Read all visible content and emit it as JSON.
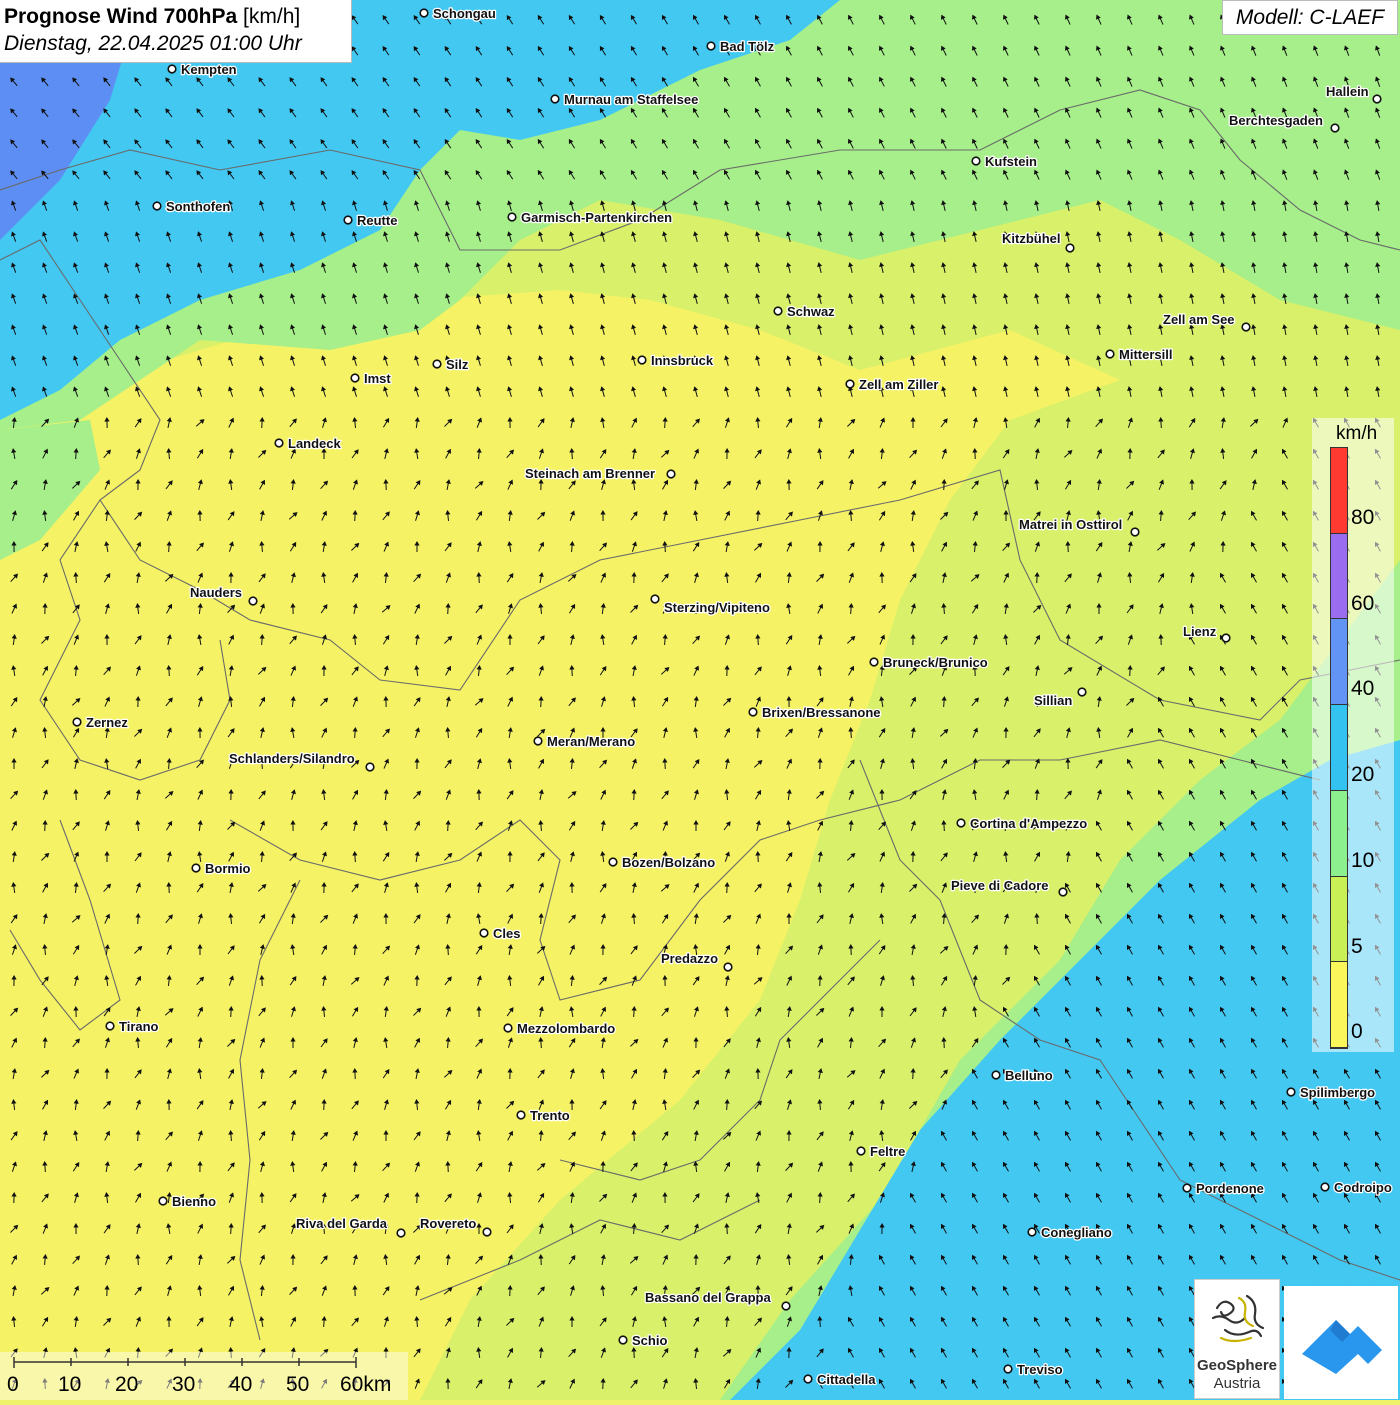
{
  "header": {
    "title_main": "Prognose Wind 700hPa",
    "title_unit": " [km/h]",
    "datetime": "Dienstag, 22.04.2025 01:00 Uhr",
    "model": "Modell: C-LAEF"
  },
  "legend": {
    "unit": "km/h",
    "ticks": [
      "80",
      "60",
      "40",
      "20",
      "10",
      "5",
      "0"
    ],
    "colors": [
      "#ff3a30",
      "#9a6cf0",
      "#6294f5",
      "#34c2f0",
      "#8cf08e",
      "#c9f055",
      "#fbf65a"
    ]
  },
  "scale_bar": {
    "labels": [
      "0",
      "10",
      "20",
      "30",
      "40",
      "50",
      "60km"
    ]
  },
  "logos": {
    "geosphere_line1": "GeoSphere",
    "geosphere_line2": "Austria"
  },
  "map": {
    "colors": {
      "calm": "#f5f265",
      "light": "#d8f06a",
      "moderate": "#a6ef8a",
      "fresh": "#43c8f2",
      "strong": "#5d8ef3",
      "border": "#6a6a6a",
      "arrow": "#111111"
    },
    "cities": [
      {
        "name": "Schongau"
      },
      {
        "name": "Bad Tölz"
      },
      {
        "name": "Kempten"
      },
      {
        "name": "Murnau am Staffelsee"
      },
      {
        "name": "Hallein"
      },
      {
        "name": "Berchtesgaden"
      },
      {
        "name": "Kufstein"
      },
      {
        "name": "Sonthofen"
      },
      {
        "name": "Reutte"
      },
      {
        "name": "Garmisch-Partenkirchen"
      },
      {
        "name": "Kitzbühel"
      },
      {
        "name": "Schwaz"
      },
      {
        "name": "Zell am See"
      },
      {
        "name": "Mittersill"
      },
      {
        "name": "Innsbruck"
      },
      {
        "name": "Silz"
      },
      {
        "name": "Imst"
      },
      {
        "name": "Zell am Ziller"
      },
      {
        "name": "Landeck"
      },
      {
        "name": "Steinach am Brenner"
      },
      {
        "name": "Matrei in Osttirol"
      },
      {
        "name": "Nauders"
      },
      {
        "name": "Sterzing/Vipiteno"
      },
      {
        "name": "Lienz"
      },
      {
        "name": "Bruneck/Brunico"
      },
      {
        "name": "Sillian"
      },
      {
        "name": "Zernez"
      },
      {
        "name": "Brixen/Bressanone"
      },
      {
        "name": "Meran/Merano"
      },
      {
        "name": "Schlanders/Silandro"
      },
      {
        "name": "Cortina d'Ampezzo"
      },
      {
        "name": "Bozen/Bolzano"
      },
      {
        "name": "Bormio"
      },
      {
        "name": "Pieve di Cadore"
      },
      {
        "name": "Cles"
      },
      {
        "name": "Predazzo"
      },
      {
        "name": "Tirano"
      },
      {
        "name": "Mezzolombardo"
      },
      {
        "name": "Belluno"
      },
      {
        "name": "Spilimbergo"
      },
      {
        "name": "Trento"
      },
      {
        "name": "Feltre"
      },
      {
        "name": "Bienno"
      },
      {
        "name": "Pordenone"
      },
      {
        "name": "Codroipo"
      },
      {
        "name": "Riva del Garda"
      },
      {
        "name": "Rovereto"
      },
      {
        "name": "Conegliano"
      },
      {
        "name": "Bassano del Grappa"
      },
      {
        "name": "Schio"
      },
      {
        "name": "Treviso"
      },
      {
        "name": "Cittadella"
      }
    ]
  }
}
